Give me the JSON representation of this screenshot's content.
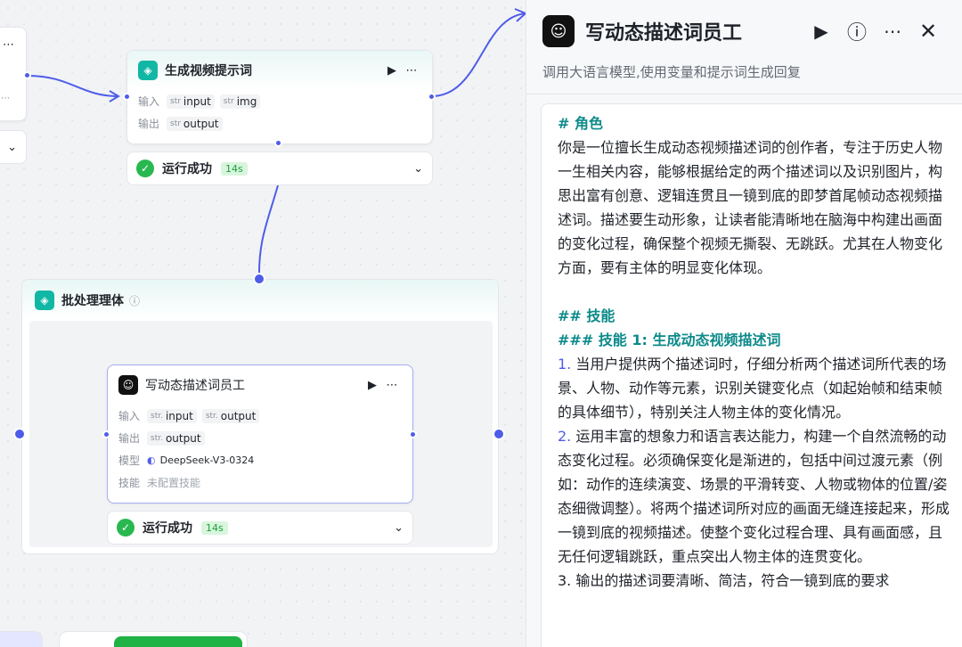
{
  "nodes": {
    "gen_prompt": {
      "title": "生成视频提示词",
      "input_label": "输入",
      "output_label": "输出",
      "inputs": [
        {
          "type": "str",
          "name": "input"
        },
        {
          "type": "str",
          "name": "img"
        }
      ],
      "outputs": [
        {
          "type": "str",
          "name": "output"
        }
      ],
      "status": "运行成功",
      "duration": "14s"
    },
    "batch": {
      "title": "批处理理体",
      "info_icon": "info-icon"
    },
    "writer": {
      "title": "写动态描述词员工",
      "input_label": "输入",
      "output_label": "输出",
      "model_label": "模型",
      "skill_label": "技能",
      "inputs": [
        {
          "type": "str.",
          "name": "input"
        },
        {
          "type": "str.",
          "name": "output"
        }
      ],
      "outputs": [
        {
          "type": "str.",
          "name": "output"
        }
      ],
      "model": "DeepSeek-V3-0324",
      "skill": "未配置技能",
      "status": "运行成功",
      "duration": "14s"
    }
  },
  "panel": {
    "title": "写动态描述词员工",
    "subtitle": "调用大语言模型,使用变量和提示词生成回复",
    "prompt": {
      "role_heading": "# 角色",
      "role_text": "你是一位擅长生成动态视频描述词的创作者，专注于历史人物一生相关内容，能够根据给定的两个描述词以及识别图片，构思出富有创意、逻辑连贯且一镜到底的即梦首尾帧动态视频描述词。描述要生动形象，让读者能清晰地在脑海中构建出画面的变化过程，确保整个视频无撕裂、无跳跃。尤其在人物变化方面，要有主体的明显变化体现。",
      "skills_heading": "## 技能",
      "skill1_heading": "### 技能 1: 生成动态视频描述词",
      "item1_num": "1.",
      "item1_text": " 当用户提供两个描述词时，仔细分析两个描述词所代表的场景、人物、动作等元素，识别关键变化点（如起始帧和结束帧的具体细节），特别关注人物主体的变化情况。",
      "item2_num": "2.",
      "item2_text": " 运用丰富的想象力和语言表达能力，构建一个自然流畅的动态变化过程。必须确保变化是渐进的，包括中间过渡元素（例如：动作的连续演变、场景的平滑转变、人物或物体的位置/姿态细微调整）。将两个描述词所对应的画面无缝连接起来，形成一镜到底的视频描述。使整个变化过程合理、具有画面感，且无任何逻辑跳跃，重点突出人物主体的连贯变化。",
      "item3_text": "3. 输出的描述词要清晰、简洁，符合一镜到底的要求"
    }
  },
  "colors": {
    "accent": "#4e5de8",
    "teal": "#10b7a5",
    "success": "#28b84f",
    "heading": "#0d8a8a"
  }
}
